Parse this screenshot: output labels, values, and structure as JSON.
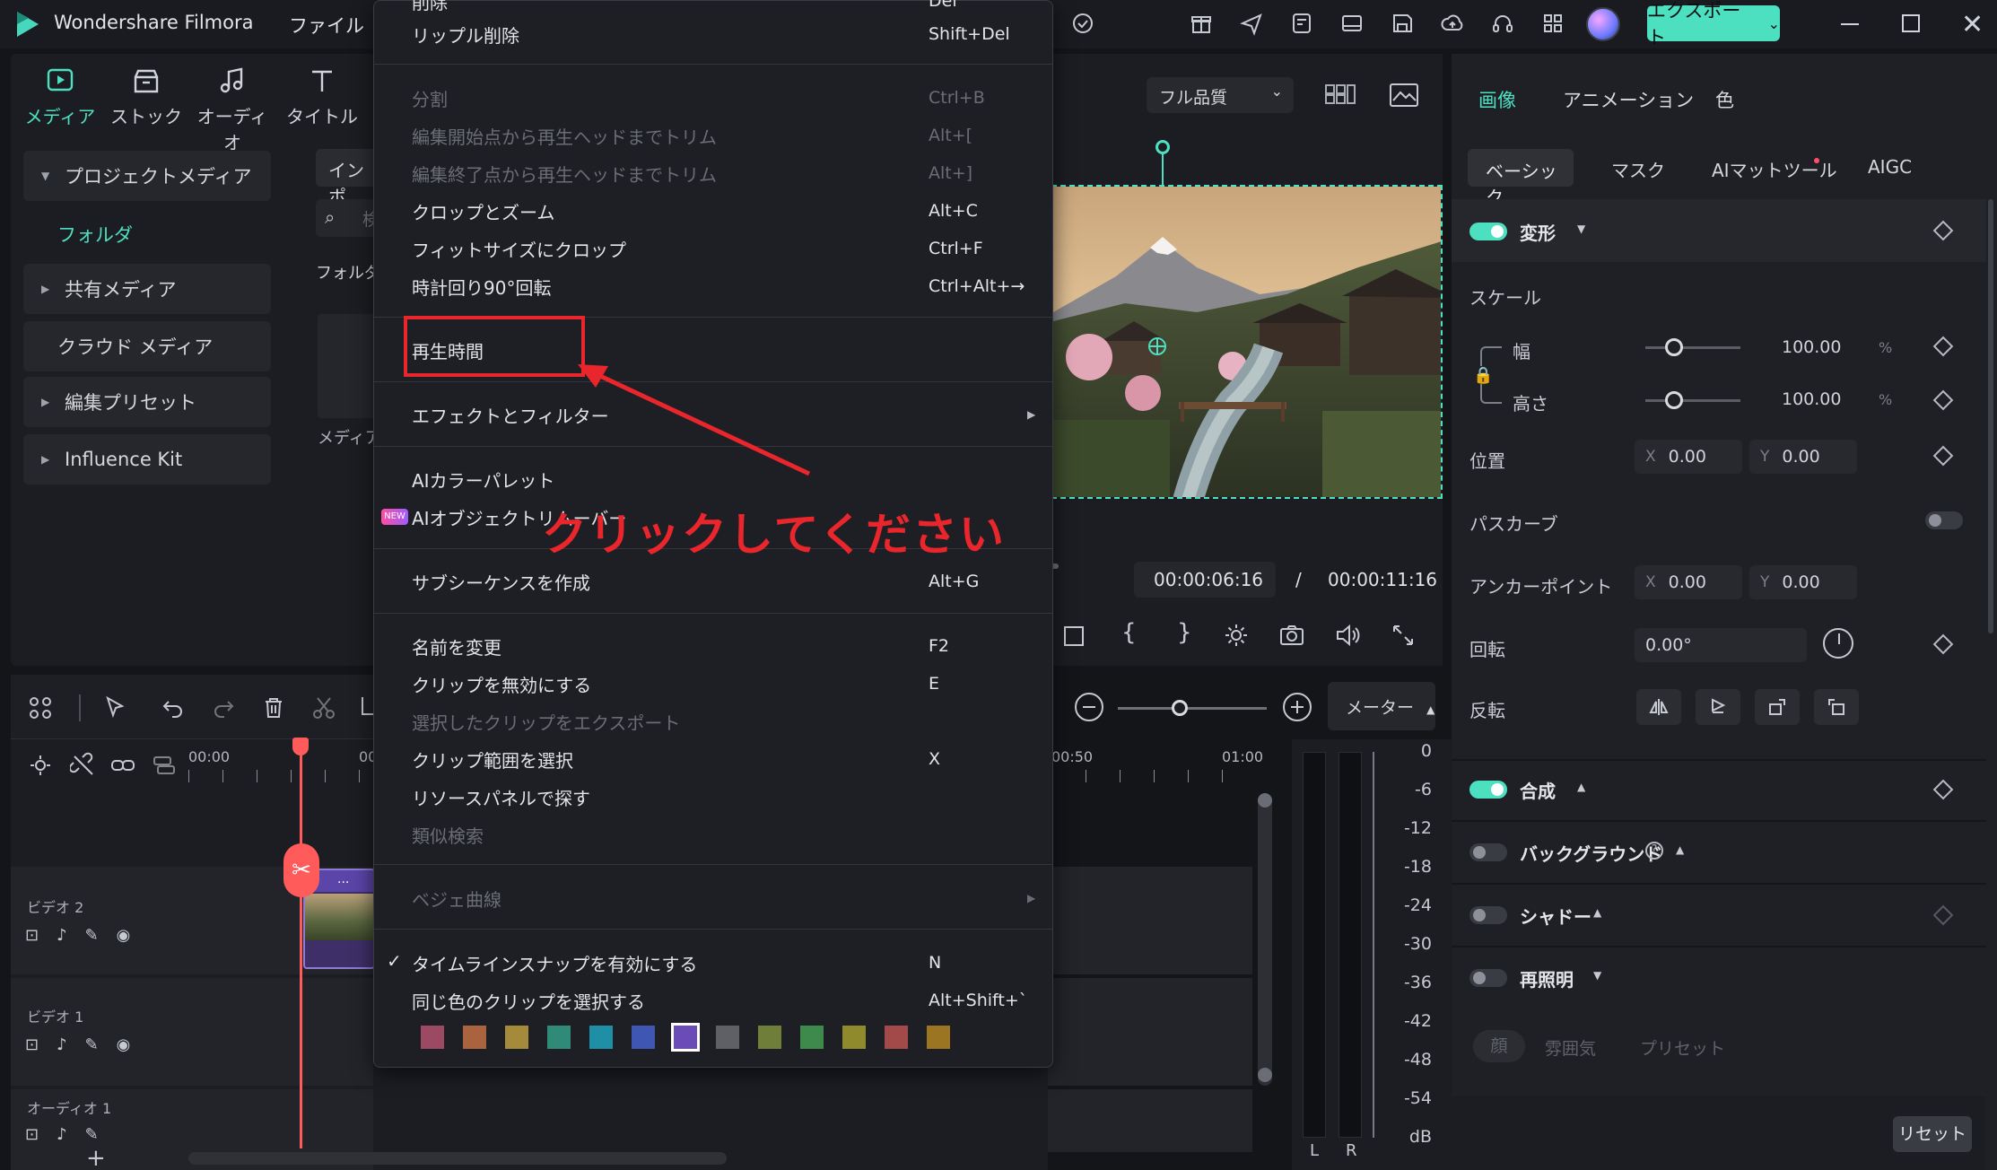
{
  "app": {
    "title": "Wondershare Filmora",
    "menu_file": "ファイル",
    "export_label": "エクスポート"
  },
  "toolbar": {
    "items": [
      {
        "label": "メディア",
        "icon": "media-icon"
      },
      {
        "label": "ストック",
        "icon": "stock-icon"
      },
      {
        "label": "オーディオ",
        "icon": "audio-icon"
      },
      {
        "label": "タイトル",
        "icon": "title-icon"
      }
    ]
  },
  "sidebar": {
    "items": [
      {
        "label": "プロジェクトメディア"
      },
      {
        "label": "フォルダ"
      },
      {
        "label": "共有メディア"
      },
      {
        "label": "クラウド メディア"
      },
      {
        "label": "編集プリセット"
      },
      {
        "label": "Influence Kit"
      }
    ]
  },
  "browser": {
    "import_label": "インポ",
    "search_placeholder": "検",
    "folder_label": "フォルダ",
    "media_label": "メディア"
  },
  "context_menu": {
    "top_cut": "削除",
    "top_cut_sc": "Del",
    "ripple_delete": "リップル削除",
    "ripple_delete_sc": "Shift+Del",
    "split": "分割",
    "split_sc": "Ctrl+B",
    "trim_start": "編集開始点から再生ヘッドまでトリム",
    "trim_start_sc": "Alt+[",
    "trim_end": "編集終了点から再生ヘッドまでトリム",
    "trim_end_sc": "Alt+]",
    "crop_zoom": "クロップとズーム",
    "crop_zoom_sc": "Alt+C",
    "crop_fit": "フィットサイズにクロップ",
    "crop_fit_sc": "Ctrl+F",
    "rotate": "時計回り90°回転",
    "rotate_sc": "Ctrl+Alt+→",
    "duration": "再生時間",
    "effects": "エフェクトとフィルター",
    "ai_palette": "AIカラーパレット",
    "ai_object": "AIオブジェクトリムーバー",
    "new_badge": "NEW",
    "subsequence": "サブシーケンスを作成",
    "subsequence_sc": "Alt+G",
    "rename": "名前を変更",
    "rename_sc": "F2",
    "disable": "クリップを無効にする",
    "disable_sc": "E",
    "export_selected": "選択したクリップをエクスポート",
    "select_range": "クリップ範囲を選択",
    "select_range_sc": "X",
    "find_resource": "リソースパネルで探す",
    "similar": "類似検索",
    "bezier": "ベジェ曲線",
    "snap": "タイムラインスナップを有効にする",
    "snap_sc": "N",
    "same_color": "同じ色のクリップを選択する",
    "same_color_sc": "Alt+Shift+`",
    "swatches": [
      "#9c4a64",
      "#a9633f",
      "#a48a3a",
      "#2f8a78",
      "#1e8fa6",
      "#3f56b3",
      "#6a4bb8",
      "#5e6066",
      "#6f7f39",
      "#3e8a4d",
      "#8f8a2c",
      "#a24a4a",
      "#9b7522"
    ]
  },
  "annotation": {
    "text": "クリックしてください"
  },
  "preview": {
    "quality": "フル品質",
    "current_time": "00:00:06:16",
    "separator": "/",
    "total_time": "00:00:11:16"
  },
  "right_panel": {
    "tabs": [
      "画像",
      "アニメーション",
      "色"
    ],
    "subtabs": [
      "ベーシック",
      "マスク",
      "AIマットツール",
      "AIGC"
    ],
    "transform": "変形",
    "scale": "スケール",
    "width": "幅",
    "height": "高さ",
    "width_val": "100.00",
    "height_val": "100.00",
    "percent": "%",
    "position": "位置",
    "pos_x": "0.00",
    "pos_y": "0.00",
    "path_curve": "パスカーブ",
    "anchor": "アンカーポイント",
    "anchor_x": "0.00",
    "anchor_y": "0.00",
    "rotation": "回転",
    "rotation_val": "0.00°",
    "flip": "反転",
    "composite": "合成",
    "background": "バックグラウンド",
    "shadow": "シャドー",
    "relight": "再照明",
    "relight_tabs": [
      "顔",
      "雰囲気",
      "プリセット"
    ],
    "reset": "リセット",
    "axis_x": "X",
    "axis_y": "Y"
  },
  "timeline": {
    "meter_label": "メーター",
    "ticks": [
      "00:00",
      "00",
      "00:50",
      "01:00"
    ],
    "tracks": [
      "ビデオ 2",
      "ビデオ 1",
      "オーディオ 1"
    ],
    "clip_label": "...",
    "meter_values": [
      "0",
      "-6",
      "-12",
      "-18",
      "-24",
      "-30",
      "-36",
      "-42",
      "-48",
      "-54",
      "dB"
    ],
    "meter_l": "L",
    "meter_r": "R"
  }
}
